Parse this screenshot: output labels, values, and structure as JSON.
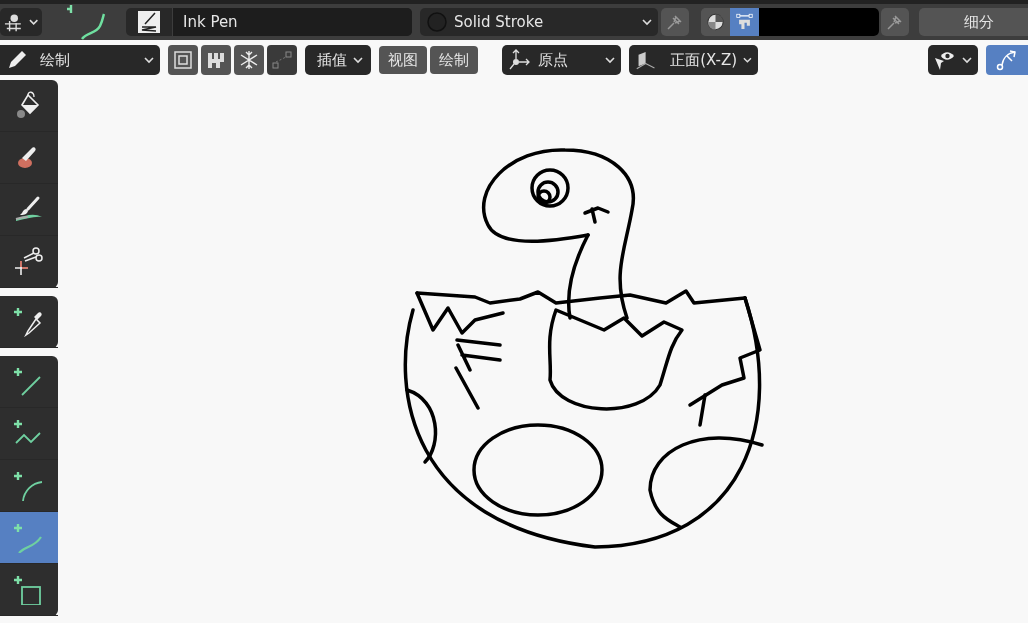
{
  "top_bar": {
    "brush_name": "Ink Pen",
    "material": "Solid Stroke",
    "color_mode": [
      {
        "kind": "material",
        "selected": false
      },
      {
        "kind": "vertex",
        "selected": true
      }
    ],
    "subdivide": "细分"
  },
  "header": {
    "mode": "绘制",
    "toggles": [
      {
        "kind": "multiframe",
        "disabled": false
      },
      {
        "kind": "autolock",
        "disabled": false
      },
      {
        "kind": "freeze",
        "disabled": false
      },
      {
        "kind": "edit-lines",
        "disabled": true
      }
    ],
    "interpolate": "插值",
    "menus": [
      "视图",
      "绘制"
    ],
    "pivot": "原点",
    "orientation": "正面(X-Z)",
    "gizmo_on": true
  },
  "tool_groups": [
    {
      "tools": [
        {
          "kind": "fill",
          "selected": false
        },
        {
          "kind": "erase",
          "selected": false
        },
        {
          "kind": "tint",
          "selected": false
        },
        {
          "kind": "cutter",
          "selected": false
        }
      ]
    },
    {
      "tools": [
        {
          "kind": "eyedropper",
          "selected": false
        }
      ]
    },
    {
      "tools": [
        {
          "kind": "line",
          "selected": false
        },
        {
          "kind": "polyline",
          "selected": false
        },
        {
          "kind": "arc",
          "selected": false
        },
        {
          "kind": "curve",
          "selected": true
        },
        {
          "kind": "box",
          "selected": false
        }
      ]
    }
  ]
}
